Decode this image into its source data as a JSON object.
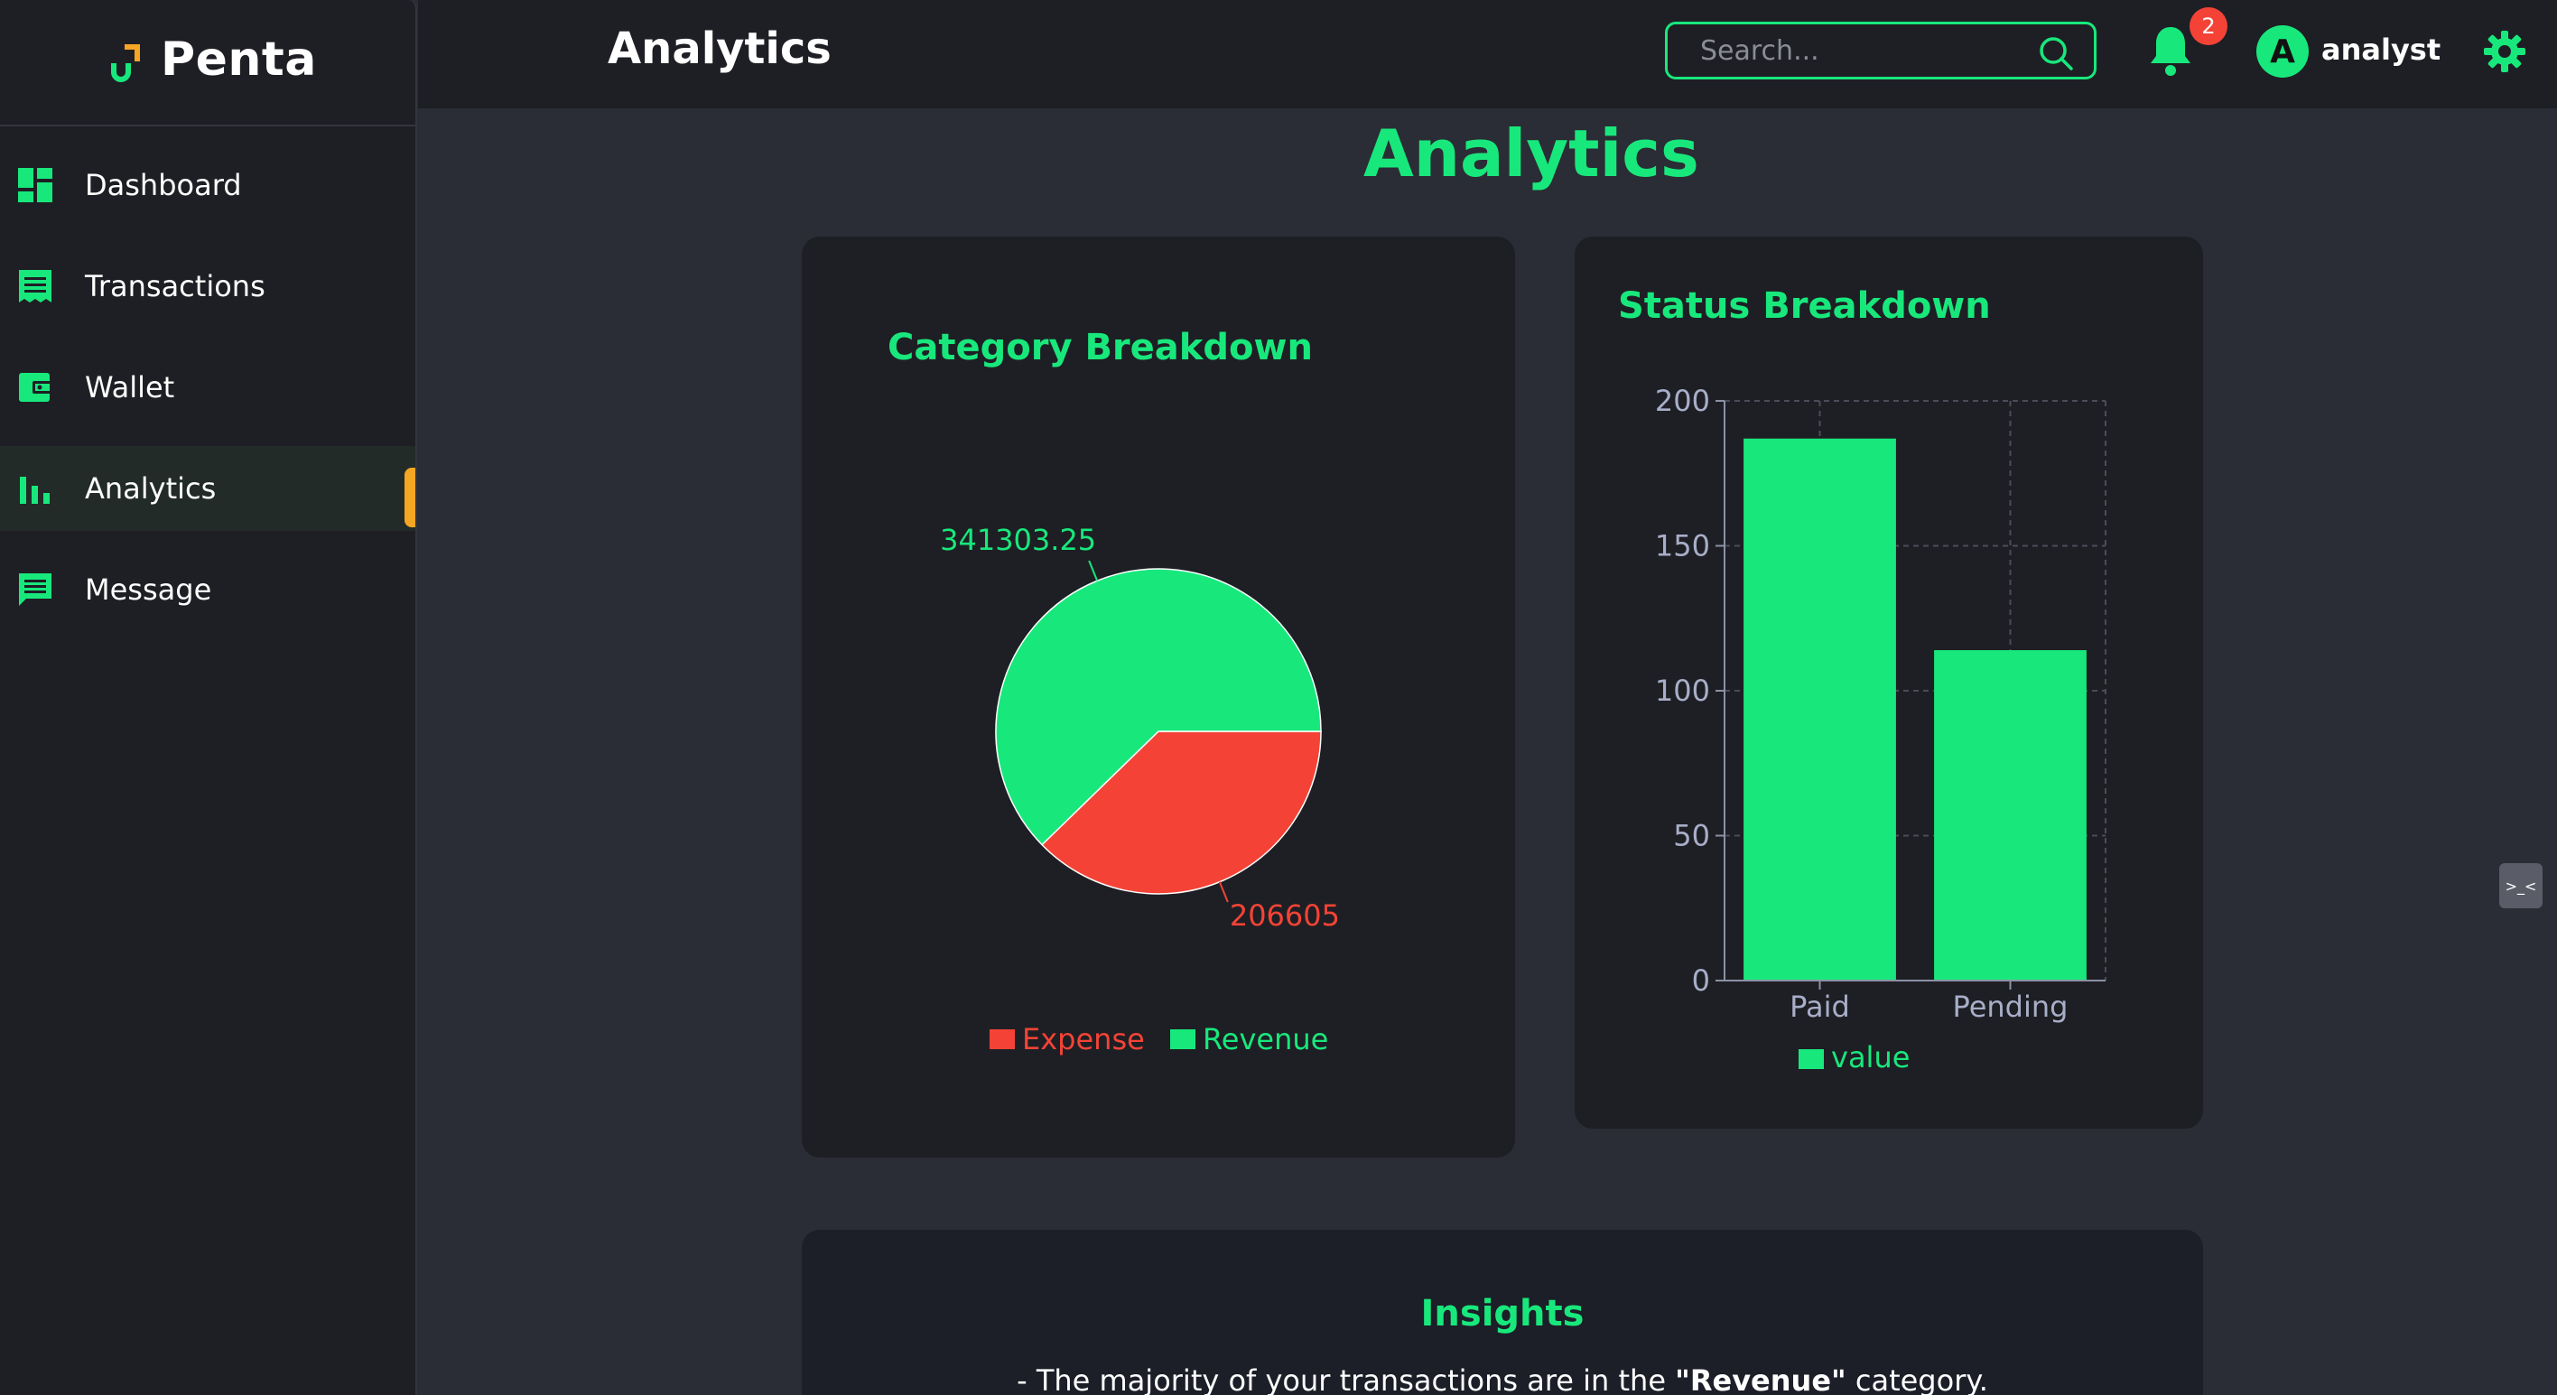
{
  "app": {
    "name": "Penta"
  },
  "sidebar": {
    "items": [
      {
        "label": "Dashboard",
        "icon": "dashboard-icon"
      },
      {
        "label": "Transactions",
        "icon": "receipt-icon"
      },
      {
        "label": "Wallet",
        "icon": "wallet-icon"
      },
      {
        "label": "Analytics",
        "icon": "bar-chart-icon",
        "active": true
      },
      {
        "label": "Message",
        "icon": "message-icon"
      }
    ]
  },
  "header": {
    "title": "Analytics",
    "search_placeholder": "Search...",
    "notification_count": "2",
    "avatar_letter": "A",
    "username": "analyst"
  },
  "page": {
    "title": "Analytics"
  },
  "colors": {
    "accent": "#18e87c",
    "expense": "#f44336",
    "warning": "#f5a623",
    "card_bg": "#1e1f24",
    "page_bg": "#2a2d35"
  },
  "chart_data": [
    {
      "type": "pie",
      "title": "Category Breakdown",
      "slices": [
        {
          "name": "Expense",
          "value": 206605,
          "label": "206605",
          "color": "#f44336"
        },
        {
          "name": "Revenue",
          "value": 341303.25,
          "label": "341303.25",
          "color": "#18e87c"
        }
      ],
      "legend": [
        "Expense",
        "Revenue"
      ],
      "legend_position": "bottom"
    },
    {
      "type": "bar",
      "title": "Status Breakdown",
      "categories": [
        "Paid",
        "Pending"
      ],
      "series": [
        {
          "name": "value",
          "values": [
            187,
            114
          ],
          "color": "#18e87c"
        }
      ],
      "ylim": [
        0,
        200
      ],
      "yticks": [
        "0",
        "50",
        "100",
        "150",
        "200"
      ],
      "grid": true,
      "legend_position": "bottom"
    }
  ],
  "insights": {
    "title": "Insights",
    "text_prefix": "- The majority of your transactions are in the ",
    "text_highlight": "\"Revenue\"",
    "text_suffix": " category."
  },
  "misc": {
    "side_widget_glyph": ">_<"
  }
}
